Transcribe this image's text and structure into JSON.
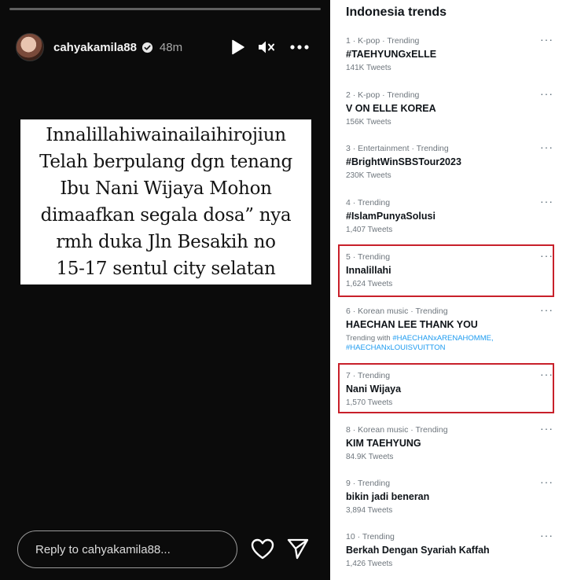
{
  "story": {
    "username": "cahyakamila88",
    "time": "48m",
    "caption_lines": [
      "Innalillahiwainailaihirojiun",
      "Telah berpulang dgn tenang",
      "Ibu Nani Wijaya Mohon",
      "dimaafkan segala dosa” nya",
      "rmh duka Jln Besakih no",
      "15-17 sentul city selatan"
    ],
    "reply_placeholder": "Reply to cahyakamila88...",
    "icons": [
      "play-icon",
      "mute-icon",
      "more-icon",
      "heart-icon",
      "send-icon",
      "verified-icon"
    ]
  },
  "trends": {
    "heading": "Indonesia trends",
    "more_label": "···",
    "items": [
      {
        "meta": "1 · K-pop · Trending",
        "name": "#TAEHYUNGxELLE",
        "count": "141K Tweets",
        "with": "",
        "tags": ""
      },
      {
        "meta": "2 · K-pop · Trending",
        "name": "V ON ELLE KOREA",
        "count": "156K Tweets",
        "with": "",
        "tags": ""
      },
      {
        "meta": "3 · Entertainment · Trending",
        "name": "#BrightWinSBSTour2023",
        "count": "230K Tweets",
        "with": "",
        "tags": ""
      },
      {
        "meta": "4 · Trending",
        "name": "#IslamPunyaSolusi",
        "count": "1,407 Tweets",
        "with": "",
        "tags": ""
      },
      {
        "meta": "5 · Trending",
        "name": "Innalillahi",
        "count": "1,624 Tweets",
        "with": "",
        "tags": ""
      },
      {
        "meta": "6 · Korean music · Trending",
        "name": "HAECHAN LEE THANK YOU",
        "count": "",
        "with": "Trending with",
        "tags": "#HAECHANxARENAHOMME,",
        "tags2": "#HAECHANxLOUISVUITTON"
      },
      {
        "meta": "7 · Trending",
        "name": "Nani Wijaya",
        "count": "1,570 Tweets",
        "with": "",
        "tags": ""
      },
      {
        "meta": "8 · Korean music · Trending",
        "name": "KIM TAEHYUNG",
        "count": "84.9K Tweets",
        "with": "",
        "tags": ""
      },
      {
        "meta": "9 · Trending",
        "name": "bikin jadi beneran",
        "count": "3,894 Tweets",
        "with": "",
        "tags": ""
      },
      {
        "meta": "10 · Trending",
        "name": "Berkah Dengan Syariah Kaffah",
        "count": "1,426 Tweets",
        "with": "",
        "tags": ""
      }
    ],
    "highlight_color": "#c8202a"
  }
}
